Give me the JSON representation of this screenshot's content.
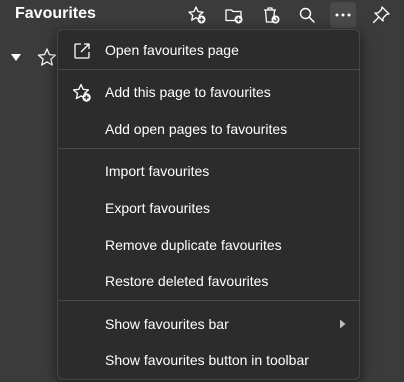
{
  "header": {
    "title": "Favourites",
    "icons": [
      "add-favourite-icon",
      "add-folder-icon",
      "delete-icon",
      "search-icon",
      "more-options-icon",
      "pin-icon"
    ]
  },
  "menu": {
    "items": [
      {
        "label": "Open favourites page",
        "icon": "open-external-icon"
      },
      {
        "label": "Add this page to favourites",
        "icon": "star-add-icon"
      },
      {
        "label": "Add open pages to favourites"
      },
      {
        "label": "Import favourites"
      },
      {
        "label": "Export favourites"
      },
      {
        "label": "Remove duplicate favourites"
      },
      {
        "label": "Restore deleted favourites"
      },
      {
        "label": "Show favourites bar",
        "has_submenu": true
      },
      {
        "label": "Show favourites button in toolbar"
      }
    ]
  },
  "colors": {
    "background": "#3b3b3b",
    "menu_background": "#2c2c2c",
    "separator": "#4a4a4a",
    "text": "#ffffff"
  }
}
